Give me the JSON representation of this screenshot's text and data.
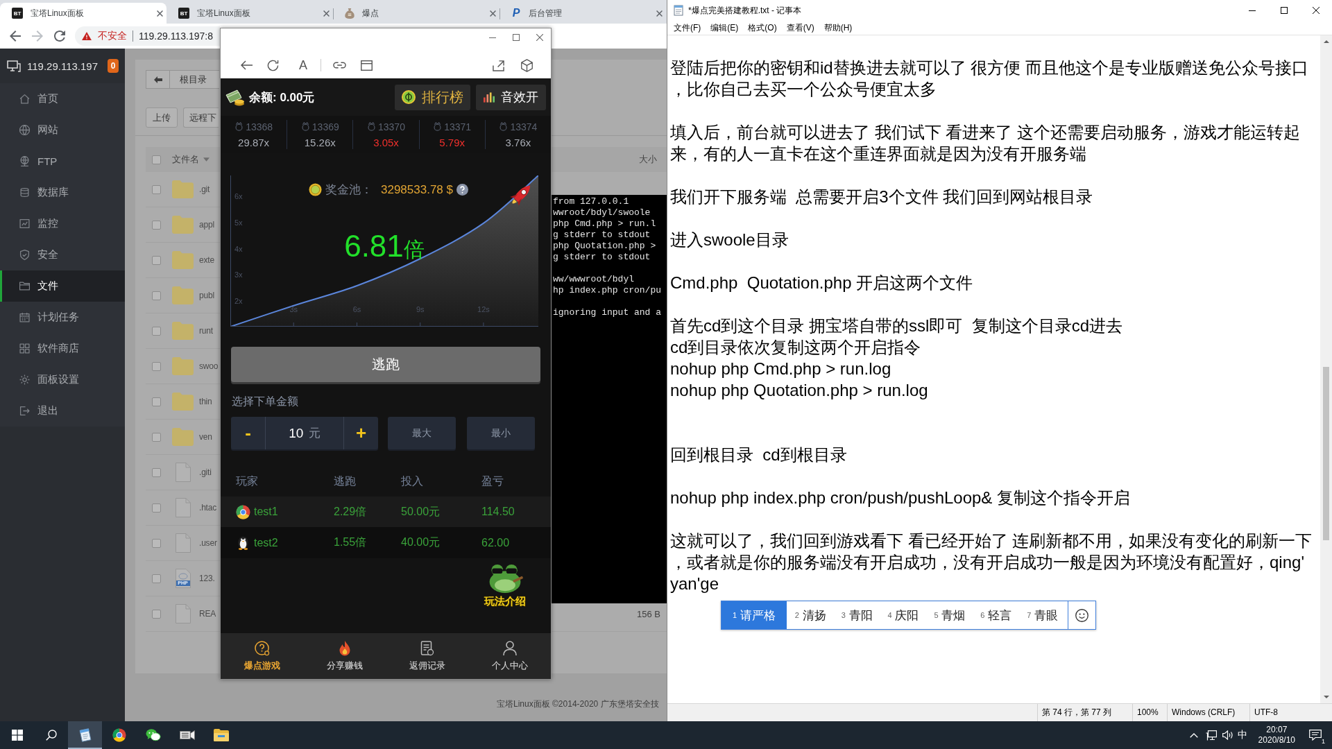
{
  "browser": {
    "tabs": [
      {
        "favicon": {
          "kind": "badge",
          "text": "BT"
        },
        "title": "宝塔Linux面板",
        "selected": true
      },
      {
        "favicon": {
          "kind": "badge",
          "text": "BT"
        },
        "title": "宝塔Linux面板",
        "selected": false
      },
      {
        "favicon": {
          "kind": "bag"
        },
        "title": "爆点",
        "selected": false
      },
      {
        "favicon": {
          "kind": "letter",
          "text": "P"
        },
        "title": "后台管理",
        "selected": false
      }
    ],
    "nav": {
      "back_disabled": false,
      "forward_disabled": true
    },
    "address": {
      "warning": "不安全",
      "url": "119.29.113.197:8"
    }
  },
  "panel": {
    "host": "119.29.113.197",
    "alerts": "0",
    "menu": [
      {
        "label": "首页",
        "selected": false
      },
      {
        "label": "网站",
        "selected": false
      },
      {
        "label": "FTP",
        "selected": false
      },
      {
        "label": "数据库",
        "selected": false
      },
      {
        "label": "监控",
        "selected": false
      },
      {
        "label": "安全",
        "selected": false
      },
      {
        "label": "文件",
        "selected": true
      },
      {
        "label": "计划任务",
        "selected": false
      },
      {
        "label": "软件商店",
        "selected": false
      },
      {
        "label": "面板设置",
        "selected": false
      },
      {
        "label": "退出",
        "selected": false
      }
    ],
    "path": "根目录",
    "actions": [
      "上传",
      "远程下"
    ],
    "files": {
      "header": {
        "checked": false,
        "name": "文件名",
        "size": "大小"
      },
      "rows": [
        {
          "kind": "folder",
          "name": ".git",
          "checked": false
        },
        {
          "kind": "folder",
          "name": "appl",
          "checked": false
        },
        {
          "kind": "folder",
          "name": "exte",
          "checked": false
        },
        {
          "kind": "folder",
          "name": "publ",
          "checked": false
        },
        {
          "kind": "folder",
          "name": "runt",
          "checked": false
        },
        {
          "kind": "folder",
          "name": "swoo",
          "checked": false
        },
        {
          "kind": "folder",
          "name": "thin",
          "checked": false
        },
        {
          "kind": "folder",
          "name": "ven",
          "checked": false
        },
        {
          "kind": "file",
          "name": ".giti",
          "checked": false
        },
        {
          "kind": "file",
          "name": ".htac",
          "checked": false
        },
        {
          "kind": "file",
          "name": ".user",
          "checked": false
        },
        {
          "kind": "php",
          "name": "123.",
          "icon_text": "PHP",
          "checked": false
        },
        {
          "kind": "file",
          "name": "REA",
          "size": "156 B",
          "checked": false
        }
      ]
    },
    "terminal": {
      "blocks": [
        [
          "from 127.0.0.1",
          "wwroot/bdyl/swoole",
          "php Cmd.php > run.l",
          "g stderr to stdout",
          "php Quotation.php >",
          "g stderr to stdout"
        ],
        [
          "ww/wwwroot/bdyl",
          "hp index.php cron/pu"
        ],
        [
          "ignoring input and a"
        ]
      ]
    },
    "footer": "宝塔Linux面板 ©2014-2020 广东堡塔安全技"
  },
  "phone": {
    "toolbar": {
      "text_button": "A"
    },
    "balance": "余额: 0.00元",
    "ranking_button": "排行榜",
    "sound_button": "音效开",
    "history": [
      {
        "round": "13368",
        "multiplier": "29.87x",
        "color": "#a9adb5"
      },
      {
        "round": "13369",
        "multiplier": "15.26x",
        "color": "#a9adb5"
      },
      {
        "round": "13370",
        "multiplier": "3.05x",
        "color": "#f0302c"
      },
      {
        "round": "13371",
        "multiplier": "5.79x",
        "color": "#f0302c"
      },
      {
        "round": "13374",
        "multiplier": "3.76x",
        "color": "#a9adb5"
      }
    ],
    "game": {
      "pool_label": "奖金池：",
      "pool_value": "3298533.78 $",
      "multiplier": "6.81",
      "unit": "倍",
      "chart_data": {
        "type": "area",
        "x": [
          0,
          3,
          6,
          9,
          12,
          14.6
        ],
        "series": [
          {
            "color": "#5b86dc",
            "values": [
              1.03,
              1.83,
              2.59,
              3.62,
              4.97,
              6.79
            ]
          }
        ],
        "xlim": [
          0,
          14.6
        ],
        "ylim": [
          1.03,
          6.79
        ],
        "xticks": [
          {
            "value": 3,
            "label": "3s"
          },
          {
            "value": 6,
            "label": "6s"
          },
          {
            "value": 9,
            "label": "9s"
          },
          {
            "value": 12,
            "label": "12s"
          }
        ],
        "yticks": [
          {
            "value": 2,
            "label": "2x"
          },
          {
            "value": 3,
            "label": "3x"
          },
          {
            "value": 4,
            "label": "4x"
          },
          {
            "value": 5,
            "label": "5x"
          },
          {
            "value": 6,
            "label": "6x"
          }
        ]
      }
    },
    "escape": "逃跑",
    "bet": {
      "label": "选择下单金额",
      "minus": "-",
      "value": "10",
      "unit": "元",
      "plus": "+",
      "max": "最大",
      "min": "最小"
    },
    "players": {
      "columns": [
        "玩家",
        "逃跑",
        "投入",
        "盈亏"
      ],
      "rows": [
        {
          "name": "test1",
          "cashout": "2.29倍",
          "stake": "50.00元",
          "profit": "114.50"
        },
        {
          "name": "test2",
          "cashout": "1.55倍",
          "stake": "40.00元",
          "profit": "62.00"
        }
      ]
    },
    "guide": "玩法介绍",
    "nav": [
      {
        "label": "爆点游戏",
        "selected": true
      },
      {
        "label": "分享赚钱",
        "selected": false
      },
      {
        "label": "返佣记录",
        "selected": false
      },
      {
        "label": "个人中心",
        "selected": false
      }
    ]
  },
  "notepad": {
    "title": "*爆点完美搭建教程.txt - 记事本",
    "menu": [
      "文件(F)",
      "编辑(E)",
      "格式(O)",
      "查看(V)",
      "帮助(H)"
    ],
    "blocks": [
      {
        "wide_gap": false,
        "lines": [
          "登陆后把你的密钥和id替换进去就可以了 很方便 而且他这个是专业版赠送免公众号接口",
          "，比你自己去买一个公众号便宜太多"
        ]
      },
      {
        "wide_gap": false,
        "lines": [
          "填入后，前台就可以进去了 我们试下 看进来了 这个还需要启动服务，游戏才能运转起",
          "来，有的人一直卡在这个重连界面就是因为没有开服务端"
        ]
      },
      {
        "wide_gap": false,
        "lines": [
          "我们开下服务端  总需要开启3个文件 我们回到网站根目录"
        ]
      },
      {
        "wide_gap": false,
        "lines": [
          "进入swoole目录"
        ]
      },
      {
        "wide_gap": false,
        "lines": [
          "Cmd.php  Quotation.php 开启这两个文件"
        ]
      },
      {
        "wide_gap": false,
        "lines": [
          "首先cd到这个目录 拥宝塔自带的ssl即可  复制这个目录cd进去",
          "cd到目录依次复制这两个开启指令",
          "nohup php Cmd.php > run.log",
          "nohup php Quotation.php > run.log"
        ]
      },
      {
        "wide_gap": true,
        "lines": [
          "回到根目录  cd到根目录"
        ]
      },
      {
        "wide_gap": false,
        "lines": [
          "nohup php index.php cron/push/pushLoop& 复制这个指令开启"
        ]
      },
      {
        "wide_gap": false,
        "lines": [
          "这就可以了，我们回到游戏看下 看已经开始了 连刷新都不用，如果没有变化的刷新一下",
          "，或者就是你的服务端没有开启成功，没有开启成功一般是因为环境没有配置好，qing'",
          "yan'ge"
        ]
      }
    ],
    "ime": {
      "candidates": [
        {
          "number": "1",
          "text": "请严格",
          "selected": true
        },
        {
          "number": "2",
          "text": "清扬",
          "selected": false
        },
        {
          "number": "3",
          "text": "青阳",
          "selected": false
        },
        {
          "number": "4",
          "text": "庆阳",
          "selected": false
        },
        {
          "number": "5",
          "text": "青烟",
          "selected": false
        },
        {
          "number": "6",
          "text": "轻言",
          "selected": false
        },
        {
          "number": "7",
          "text": "青眼",
          "selected": false
        }
      ]
    },
    "status": [
      "第 74 行，第 77 列",
      "100%",
      "Windows (CRLF)",
      "UTF-8"
    ]
  },
  "taskbar": {
    "apps": [
      {
        "selected": true
      },
      {
        "selected": false
      },
      {
        "selected": false
      },
      {
        "selected": false
      },
      {
        "selected": false
      }
    ],
    "tray": {
      "ime": "中",
      "time": "20:07",
      "date": "2020/8/10",
      "notifications": "1"
    }
  }
}
